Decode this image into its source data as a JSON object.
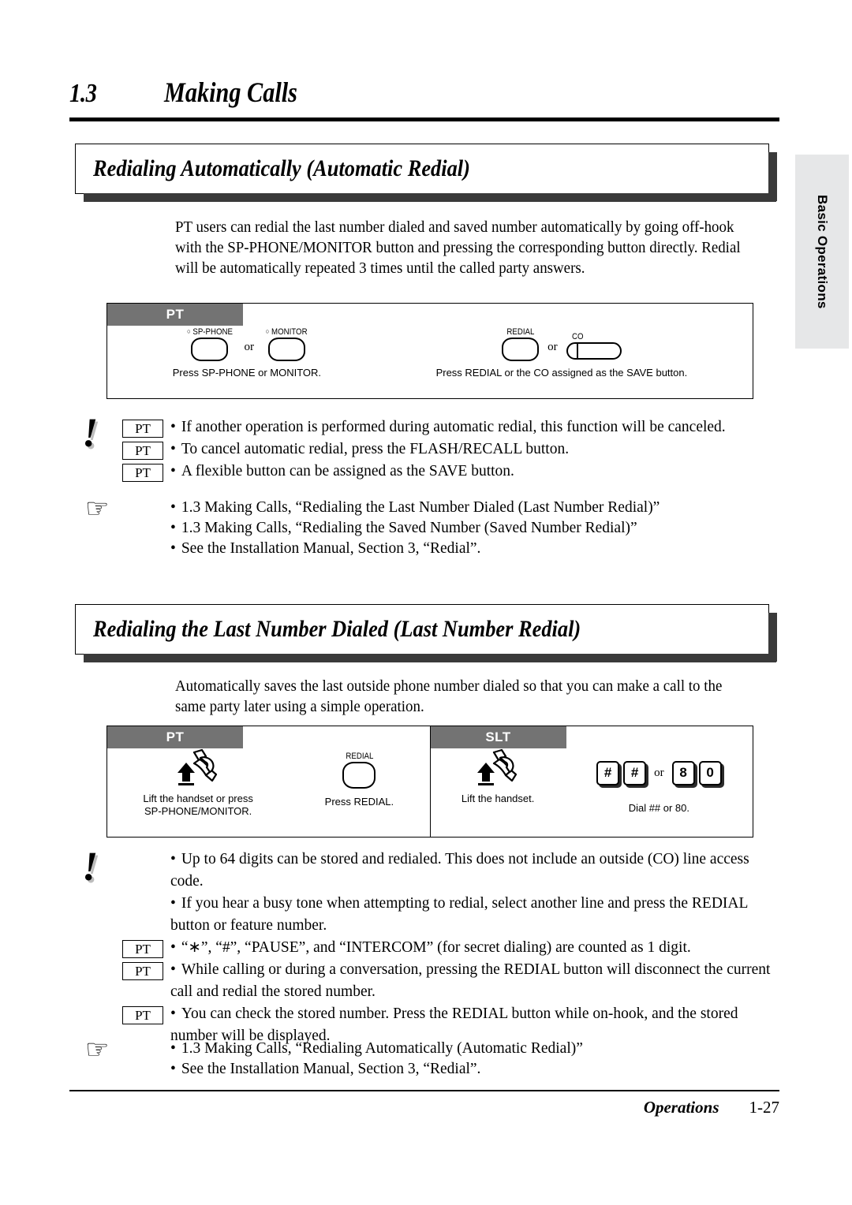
{
  "chapter": {
    "number": "1.3",
    "title": "Making Calls"
  },
  "side_tab": {
    "label": "Basic Operations"
  },
  "sections": [
    {
      "title": "Redialing Automatically (Automatic Redial)",
      "body": "PT users can redial the last number dialed and saved number automatically by going off-hook with the SP-PHONE/MONITOR button and pressing the corresponding button directly. Redial will be automatically repeated 3 times until the called party answers."
    },
    {
      "title": "Redialing the Last Number Dialed (Last Number Redial)",
      "body": "Automatically saves the last outside phone number dialed so that you can make a call to the same party later using a simple operation."
    }
  ],
  "diagram1": {
    "tab": "PT",
    "steps": [
      {
        "buttons": [
          {
            "type": "round",
            "label": "SP-PHONE",
            "led": true
          },
          {
            "type": "or",
            "label": "or"
          },
          {
            "type": "round",
            "label": "MONITOR",
            "led": true
          }
        ],
        "caption": "Press SP-PHONE or MONITOR."
      },
      {
        "buttons": [
          {
            "type": "round",
            "label": "REDIAL",
            "led": false
          },
          {
            "type": "or",
            "label": "or"
          },
          {
            "type": "pill",
            "label": "CO",
            "led": false
          }
        ],
        "caption": "Press REDIAL or the CO assigned as the SAVE button."
      }
    ]
  },
  "diagram2": {
    "pt": {
      "tab": "PT",
      "steps": [
        {
          "icon": "handset-lift-icon",
          "caption": "Lift the handset or press\nSP-PHONE/MONITOR."
        },
        {
          "button_label": "REDIAL",
          "caption": "Press REDIAL."
        }
      ]
    },
    "slt": {
      "tab": "SLT",
      "steps": [
        {
          "icon": "handset-lift-icon",
          "caption": "Lift the handset."
        },
        {
          "keys": [
            "#",
            "#",
            "or",
            "8",
            "0"
          ],
          "caption": "Dial ## or 80."
        }
      ]
    }
  },
  "notes1": {
    "icon": "warning-exclamation-icon",
    "items": [
      {
        "chip": "PT",
        "text": "If another operation is performed during automatic redial, this function will be canceled."
      },
      {
        "chip": "PT",
        "text": "To cancel automatic redial, press the FLASH/RECALL button."
      },
      {
        "chip": "PT",
        "text": "A flexible button can be assigned as the SAVE button."
      }
    ]
  },
  "refs1": {
    "icon": "pointing-hand-icon",
    "items": [
      "1.3 Making Calls, “Redialing the Last Number Dialed (Last Number Redial)”",
      "1.3 Making Calls, “Redialing the Saved Number (Saved Number Redial)”",
      "See the Installation Manual, Section 3, “Redial”."
    ]
  },
  "notes2": {
    "icon": "warning-exclamation-icon",
    "items": [
      {
        "chip": "",
        "text": "Up to 64 digits can be stored and redialed. This does not include an outside (CO) line access code."
      },
      {
        "chip": "",
        "text": "If you hear a busy tone when attempting to redial, select another line and press the REDIAL button or feature number."
      },
      {
        "chip": "PT",
        "text": "“∗”, “#”, “PAUSE”, and “INTERCOM” (for secret dialing) are counted as 1 digit."
      },
      {
        "chip": "PT",
        "text": "While calling or during a conversation, pressing the REDIAL button will disconnect the current call and redial the stored number."
      },
      {
        "chip": "PT",
        "text": "You can check the stored number. Press the REDIAL button while on-hook, and the stored number will be displayed."
      }
    ]
  },
  "refs2": {
    "icon": "pointing-hand-icon",
    "items": [
      "1.3 Making Calls, “Redialing Automatically (Automatic Redial)”",
      "See the Installation Manual, Section 3, “Redial”."
    ]
  },
  "footer": {
    "label": "Operations",
    "page": "1-27"
  },
  "colors": {
    "tab_gray": "#737373",
    "side_tab_gray": "#e6e7e8",
    "shadow": "#3a3a3a"
  }
}
